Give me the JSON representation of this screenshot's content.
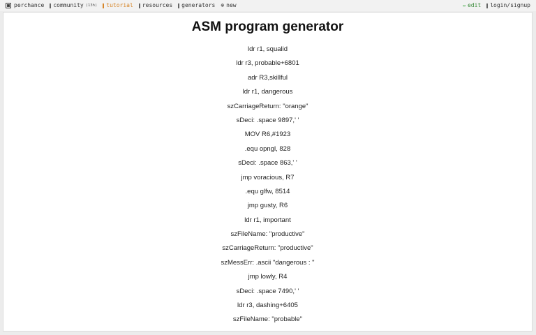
{
  "topbar": {
    "nav": [
      {
        "label": "perchance",
        "icon": "dice-icon",
        "active": false
      },
      {
        "label": "community",
        "badge": "(13h)",
        "icon": "community-icon",
        "active": false
      },
      {
        "label": "tutorial",
        "icon": "tutorial-icon",
        "active": true
      },
      {
        "label": "resources",
        "icon": "resources-icon",
        "active": false
      },
      {
        "label": "generators",
        "icon": "generators-icon",
        "active": false
      },
      {
        "label": "new",
        "icon": "plus-circle-icon",
        "active": false
      }
    ],
    "edit_label": "edit",
    "login_label": "login/signup"
  },
  "colors": {
    "accent": "#d6862a",
    "edit": "#3c8c3c"
  },
  "page": {
    "title": "ASM program generator",
    "lines": [
      "ldr r1, squalid",
      "ldr r3, probable+6801",
      "adr R3,skillful",
      "ldr r1, dangerous",
      "szCarriageReturn: \"orange\"",
      "sDeci: .space 9897,' '",
      "MOV R6,#1923",
      ".equ opngl, 828",
      "sDeci: .space 863,' '",
      "jmp voracious, R7",
      ".equ glfw, 8514",
      "jmp gusty, R6",
      "ldr r1, important",
      "szFileName: \"productive\"",
      "szCarriageReturn: \"productive\"",
      "szMessErr: .ascii \"dangerous : \"",
      "jmp lowly, R4",
      "sDeci: .space 7490,' '",
      "ldr r3, dashing+6405",
      "szFileName: \"probable\""
    ]
  }
}
